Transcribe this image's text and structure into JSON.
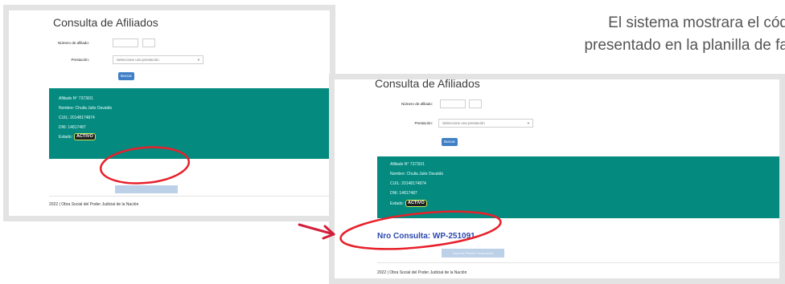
{
  "caption": {
    "line1": "El sistema mostrara el cód",
    "line2": "presentado en la planilla de fa"
  },
  "screen_a": {
    "title": "Consulta de Afiliados",
    "affiliate_number_label": "Número de afiliado:",
    "service_label": "Prestación:",
    "service_placeholder": "Seleccione una prestación",
    "search_button": "Buscar",
    "result": {
      "affiliate": "Afiliado N° 73730/1",
      "name": "Nombre: Chulia Julio Osvaldo",
      "cuil": "CUIL: 20148174874",
      "dni": "DNI: 14817487",
      "status_label": "Estado:",
      "status_badge": "ACTIVO"
    },
    "footer": "2022 | Obra Social del Poder Judicial de la Nación"
  },
  "screen_b": {
    "title": "Consulta de Afiliados",
    "affiliate_number_label": "Número de afiliado:",
    "service_label": "Prestación:",
    "service_placeholder": "Seleccione una prestación",
    "search_button": "Buscar",
    "result": {
      "affiliate": "Afiliado N° 73730/1",
      "name": "Nombre: Chulia Julio Osvaldo",
      "cuil": "CUIL: 20148174874",
      "dni": "DNI: 14817487",
      "status_label": "Estado:",
      "status_badge": "ACTIVO"
    },
    "consultation": "Nro Consulta: WP-251091",
    "print_button": "Imprimir Planilla Facturación",
    "footer": "2022 | Obra Social del Poder Judicial de la Nación"
  },
  "colors": {
    "panel": "#058a80",
    "button": "#3f7fc6",
    "badge_border": "#c7ea5a",
    "annotation": "#e8202a",
    "consultation_text": "#2c48b0"
  }
}
